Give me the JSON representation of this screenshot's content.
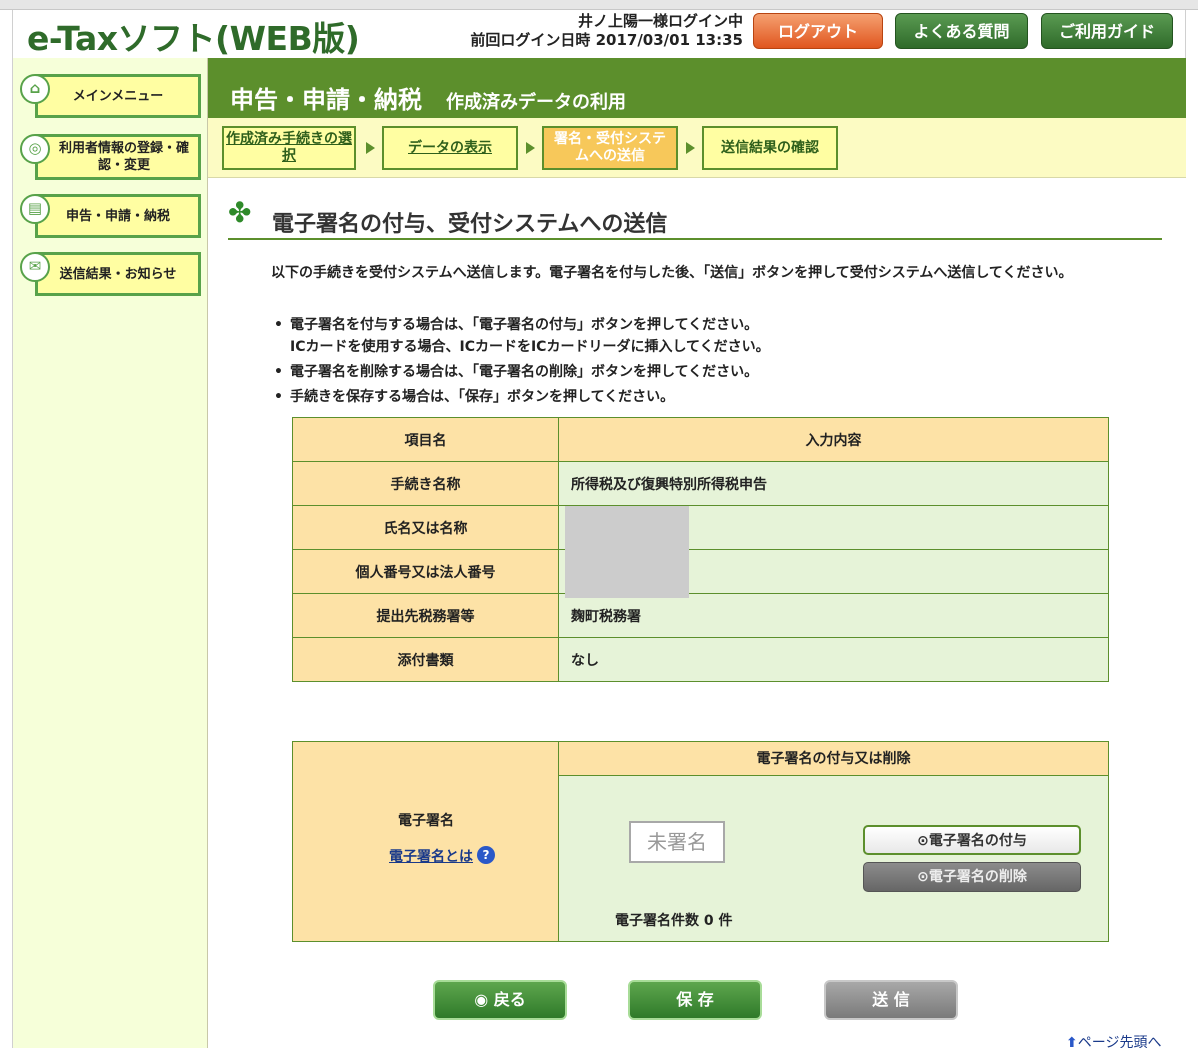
{
  "header": {
    "logo": "e-Taxソフト(WEB版)",
    "user_login": "井ノ上陽一様ログイン中",
    "last_login": "前回ログイン日時 2017/03/01 13:35",
    "logout": "ログアウト",
    "faq": "よくある質問",
    "guide": "ご利用ガイド"
  },
  "sidebar": {
    "items": [
      {
        "label": "メインメニュー",
        "icon": "home-icon"
      },
      {
        "label": "利用者情報の登録・確認・変更",
        "icon": "user-settings-icon"
      },
      {
        "label": "申告・申請・納税",
        "icon": "document-icon"
      },
      {
        "label": "送信結果・お知らせ",
        "icon": "mail-icon"
      }
    ]
  },
  "main": {
    "title": "申告・申請・納税",
    "subtitle": "作成済みデータの利用",
    "steps": [
      {
        "label": "作成済み手続きの選択"
      },
      {
        "label": "データの表示"
      },
      {
        "label": "署名・受付システムへの送信"
      },
      {
        "label": "送信結果の確認"
      }
    ],
    "section_title": "電子署名の付与、受付システムへの送信",
    "intro": "以下の手続きを受付システムへ送信します。電子署名を付与した後、「送信」ボタンを押して受付システムへ送信してください。",
    "bullets": [
      "電子署名を付与する場合は、「電子署名の付与」ボタンを押してください。",
      "ICカードを使用する場合、ICカードをICカードリーダに挿入してください。",
      "電子署名を削除する場合は、「電子署名の削除」ボタンを押してください。",
      "手続きを保存する場合は、「保存」ボタンを押してください。"
    ],
    "table": {
      "header_key": "項目名",
      "header_value": "入力内容",
      "rows": [
        {
          "key": "手続き名称",
          "value": "所得税及び復興特別所得税申告"
        },
        {
          "key": "氏名又は名称",
          "value": ""
        },
        {
          "key": "個人番号又は法人番号",
          "value": ""
        },
        {
          "key": "提出先税務署等",
          "value": "麹町税務署"
        },
        {
          "key": "添付書類",
          "value": "なし"
        }
      ]
    },
    "signature": {
      "label": "電子署名",
      "link": "電子署名とは",
      "help": "?",
      "header": "電子署名の付与又は削除",
      "status": "未署名",
      "add_button": "電子署名の付与",
      "delete_button": "電子署名の削除",
      "count": "電子署名件数 0 件"
    },
    "buttons": {
      "back": "戻る",
      "save": "保 存",
      "send": "送 信"
    },
    "page_top": "ページ先頭へ"
  }
}
